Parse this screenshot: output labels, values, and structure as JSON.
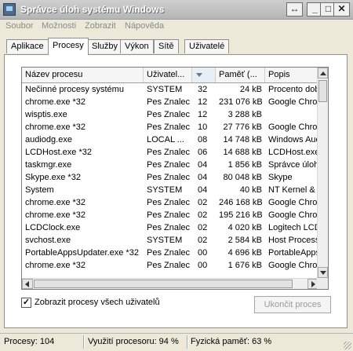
{
  "window": {
    "title": "Správce úloh systému Windows",
    "buttons": {
      "restore": "↔",
      "minimize": "_",
      "maximize": "□",
      "close": "✕"
    }
  },
  "menu": [
    "Soubor",
    "Možnosti",
    "Zobrazit",
    "Nápověda"
  ],
  "tabs": [
    "Aplikace",
    "Procesy",
    "Služby",
    "Výkon",
    "Sítě",
    "Uživatelé"
  ],
  "active_tab": "Procesy",
  "table": {
    "columns": [
      "Název procesu",
      "Uživatel...",
      "",
      "Paměť (...",
      "Popis"
    ],
    "sorted_column": 2,
    "rows": [
      [
        "Nečinné procesy systému",
        "SYSTEM",
        "32",
        "24 kB",
        "Procento dob"
      ],
      [
        "chrome.exe *32",
        "Pes Znalec",
        "12",
        "231 076 kB",
        "Google Chron"
      ],
      [
        "wisptis.exe",
        "Pes Znalec",
        "12",
        "3 288 kB",
        ""
      ],
      [
        "chrome.exe *32",
        "Pes Znalec",
        "10",
        "27 776 kB",
        "Google Chron"
      ],
      [
        "audiodg.exe",
        "LOCAL ...",
        "08",
        "14 748 kB",
        "Windows Auc"
      ],
      [
        "LCDHost.exe *32",
        "Pes Znalec",
        "06",
        "14 688 kB",
        "LCDHost.exe"
      ],
      [
        "taskmgr.exe",
        "Pes Znalec",
        "04",
        "1 856 kB",
        "Správce úloh"
      ],
      [
        "Skype.exe *32",
        "Pes Znalec",
        "04",
        "80 048 kB",
        "Skype"
      ],
      [
        "System",
        "SYSTEM",
        "04",
        "40 kB",
        "NT Kernel & S"
      ],
      [
        "chrome.exe *32",
        "Pes Znalec",
        "02",
        "246 168 kB",
        "Google Chron"
      ],
      [
        "chrome.exe *32",
        "Pes Znalec",
        "02",
        "195 216 kB",
        "Google Chron"
      ],
      [
        "LCDClock.exe",
        "Pes Znalec",
        "02",
        "4 020 kB",
        "Logitech LCD"
      ],
      [
        "svchost.exe",
        "SYSTEM",
        "02",
        "2 584 kB",
        "Host Process"
      ],
      [
        "PortableAppsUpdater.exe *32",
        "Pes Znalec",
        "00",
        "4 696 kB",
        "PortableApps"
      ],
      [
        "chrome.exe *32",
        "Pes Znalec",
        "00",
        "1 676 kB",
        "Google Chron"
      ]
    ]
  },
  "show_all_users": {
    "label": "Zobrazit procesy všech uživatelů",
    "checked": true,
    "mark": "✓"
  },
  "end_process_button": "Ukončit proces",
  "status": {
    "processes": "Procesy: 104",
    "cpu": "Využití procesoru: 94 %",
    "memory": "Fyzická paměť: 63 %"
  }
}
